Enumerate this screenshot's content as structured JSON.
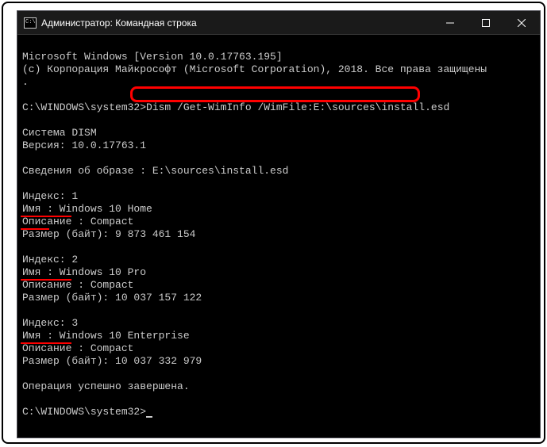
{
  "window": {
    "title": "Администратор: Командная строка"
  },
  "console": {
    "header_line1": "Microsoft Windows [Version 10.0.17763.195]",
    "header_line2": "(c) Корпорация Майкрософт (Microsoft Corporation), 2018. Все права защищены",
    "header_line3": ".",
    "prompt1_path": "C:\\WINDOWS\\system32>",
    "prompt1_cmd": "Dism /Get-WimInfo /WimFile:E:\\sources\\install.esd",
    "system_line": "Cистема DISM",
    "version_line": "Версия: 10.0.17763.1",
    "info_line": "Сведения об образе : E:\\sources\\install.esd",
    "idx1_header": "Индекс: 1",
    "idx1_name": "Имя : Windows 10 Home",
    "idx1_desc": "Описание : Compact",
    "idx1_size": "Размер (байт): 9 873 461 154",
    "idx2_header": "Индекс: 2",
    "idx2_name": "Имя : Windows 10 Pro",
    "idx2_desc": "Описание : Compact",
    "idx2_size": "Размер (байт): 10 037 157 122",
    "idx3_header": "Индекс: 3",
    "idx3_name": "Имя : Windows 10 Enterprise",
    "idx3_desc": "Описание : Compact",
    "idx3_size": "Размер (байт): 10 037 332 979",
    "success_line": "Операция успешно завершена.",
    "prompt2_path": "C:\\WINDOWS\\system32>"
  }
}
